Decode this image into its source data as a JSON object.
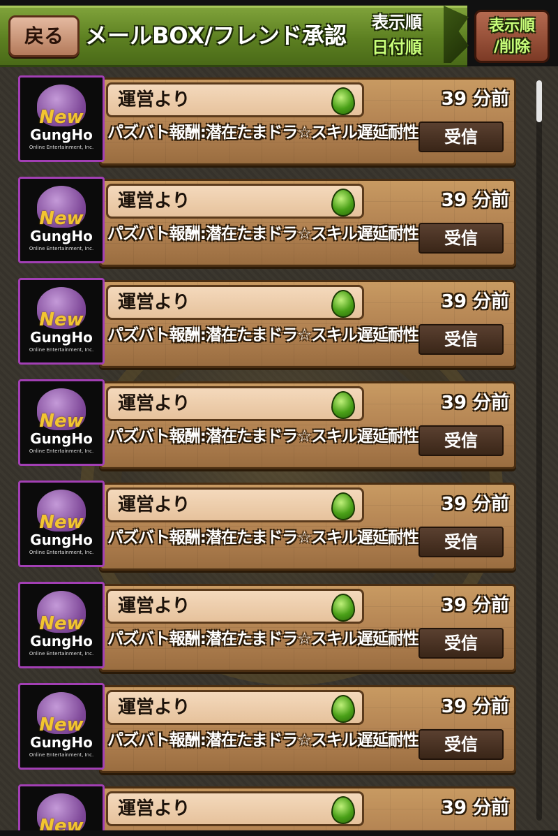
{
  "header": {
    "back_label": "戻る",
    "title": "メールBOX/フレンド承認",
    "sort_label": "表示順",
    "sort_value": "日付順",
    "sort_delete_line1": "表示順",
    "sort_delete_line2": "/削除"
  },
  "mails": [
    {
      "sender": "運営より",
      "time": "39 分前",
      "subject": "パズバト報酬:潜在たまドラ☆スキル遅延耐性",
      "action": "受信",
      "logo_new": "New",
      "logo_brand": "GungHo",
      "logo_sub": "Online Entertainment, Inc."
    },
    {
      "sender": "運営より",
      "time": "39 分前",
      "subject": "パズバト報酬:潜在たまドラ☆スキル遅延耐性",
      "action": "受信",
      "logo_new": "New",
      "logo_brand": "GungHo",
      "logo_sub": "Online Entertainment, Inc."
    },
    {
      "sender": "運営より",
      "time": "39 分前",
      "subject": "パズバト報酬:潜在たまドラ☆スキル遅延耐性",
      "action": "受信",
      "logo_new": "New",
      "logo_brand": "GungHo",
      "logo_sub": "Online Entertainment, Inc."
    },
    {
      "sender": "運営より",
      "time": "39 分前",
      "subject": "パズバト報酬:潜在たまドラ☆スキル遅延耐性",
      "action": "受信",
      "logo_new": "New",
      "logo_brand": "GungHo",
      "logo_sub": "Online Entertainment, Inc."
    },
    {
      "sender": "運営より",
      "time": "39 分前",
      "subject": "パズバト報酬:潜在たまドラ☆スキル遅延耐性",
      "action": "受信",
      "logo_new": "New",
      "logo_brand": "GungHo",
      "logo_sub": "Online Entertainment, Inc."
    },
    {
      "sender": "運営より",
      "time": "39 分前",
      "subject": "パズバト報酬:潜在たまドラ☆スキル遅延耐性",
      "action": "受信",
      "logo_new": "New",
      "logo_brand": "GungHo",
      "logo_sub": "Online Entertainment, Inc."
    },
    {
      "sender": "運営より",
      "time": "39 分前",
      "subject": "パズバト報酬:潜在たまドラ☆スキル遅延耐性",
      "action": "受信",
      "logo_new": "New",
      "logo_brand": "GungHo",
      "logo_sub": "Online Entertainment, Inc."
    },
    {
      "sender": "運営より",
      "time": "39 分前",
      "subject": "",
      "action": "",
      "logo_new": "New",
      "logo_brand": "",
      "logo_sub": ""
    }
  ],
  "icons": {
    "reward": "egg-icon",
    "sender_logo": "gungho-logo-icon"
  },
  "colors": {
    "header_green": "#6a8f2a",
    "panel_brown": "#b08050",
    "highlight_green": "#c9ff7a",
    "avatar_border": "#a23fb4"
  }
}
